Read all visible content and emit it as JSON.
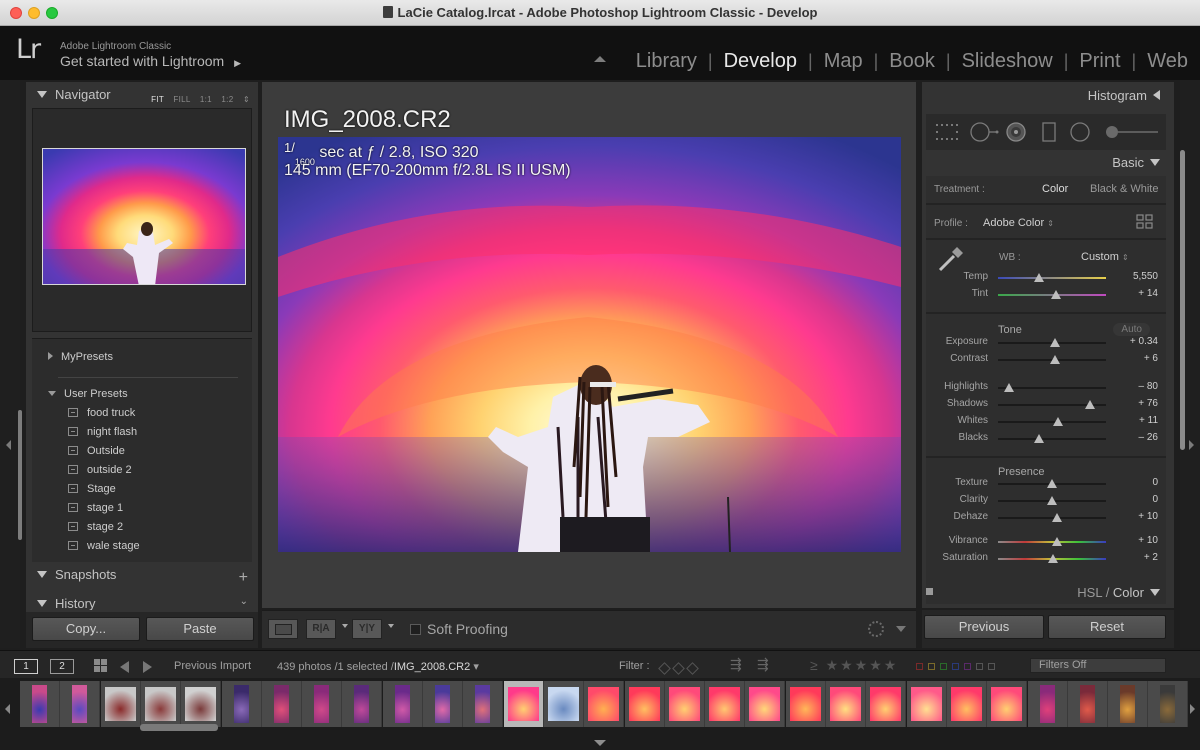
{
  "window": {
    "title": "LaCie Catalog.lrcat - Adobe Photoshop Lightroom Classic - Develop"
  },
  "identity_plate": {
    "logo": "Lr",
    "small": "Adobe Lightroom Classic",
    "big": "Get started with Lightroom",
    "arrow": "▶"
  },
  "modules": [
    {
      "label": "Library"
    },
    {
      "label": "Develop"
    },
    {
      "label": "Map"
    },
    {
      "label": "Book"
    },
    {
      "label": "Slideshow"
    },
    {
      "label": "Print"
    },
    {
      "label": "Web"
    }
  ],
  "active_module": "Develop",
  "left_panel": {
    "navigator": {
      "title": "Navigator",
      "zoom": [
        "FIT",
        "FILL",
        "1:1",
        "1:2"
      ],
      "zoom_arrows": "⇕"
    },
    "presets": {
      "my_presets": "MyPresets",
      "user_presets": "User Presets",
      "items": [
        "food truck",
        "night flash",
        "Outside",
        "outside 2",
        "Stage",
        "stage 1",
        "stage 2",
        "wale stage"
      ]
    },
    "snapshots": {
      "title": "Snapshots",
      "add": "+"
    },
    "history": {
      "title": "History",
      "chevron": "⌄"
    },
    "copy_button": "Copy...",
    "paste_button": "Paste"
  },
  "photo": {
    "filename": "IMG_2008.CR2",
    "shutter_num": "1/",
    "shutter_den": "1600",
    "exposure_rest": " sec at ƒ / 2.8, ISO 320",
    "lens_line": "145 mm (EF70-200mm f/2.8L IS II USM)"
  },
  "toolbar": {
    "before_after_1": "R|A",
    "before_after_2": "Y|Y",
    "soft_proofing": "Soft Proofing"
  },
  "right_panel": {
    "histogram": "Histogram",
    "basic": "Basic",
    "treatment_label": "Treatment :",
    "treatment_color": "Color",
    "treatment_bw": "Black & White",
    "profile_label": "Profile :",
    "profile_value": "Adobe Color",
    "profile_arrow": "⇕",
    "wb_label": "WB :",
    "wb_value": "Custom",
    "wb_arrow": "⇕",
    "tone_title": "Tone",
    "auto": "Auto",
    "presence_title": "Presence",
    "hsl_label": "HSL",
    "color_label": "Color",
    "hsl_sep": " / ",
    "sliders": {
      "temp": {
        "label": "Temp",
        "value": "5,550",
        "pos": 0.38
      },
      "tint": {
        "label": "Tint",
        "value": "+ 14",
        "pos": 0.54
      },
      "exposure": {
        "label": "Exposure",
        "value": "+ 0.34",
        "pos": 0.53
      },
      "contrast": {
        "label": "Contrast",
        "value": "+ 6",
        "pos": 0.53
      },
      "highlights": {
        "label": "Highlights",
        "value": "– 80",
        "pos": 0.1
      },
      "shadows": {
        "label": "Shadows",
        "value": "+ 76",
        "pos": 0.85
      },
      "whites": {
        "label": "Whites",
        "value": "+ 11",
        "pos": 0.56
      },
      "blacks": {
        "label": "Blacks",
        "value": "– 26",
        "pos": 0.38
      },
      "texture": {
        "label": "Texture",
        "value": "0",
        "pos": 0.5
      },
      "clarity": {
        "label": "Clarity",
        "value": "0",
        "pos": 0.5
      },
      "dehaze": {
        "label": "Dehaze",
        "value": "+ 10",
        "pos": 0.55
      },
      "vibrance": {
        "label": "Vibrance",
        "value": "+ 10",
        "pos": 0.55
      },
      "saturation": {
        "label": "Saturation",
        "value": "+ 2",
        "pos": 0.51
      }
    },
    "previous_button": "Previous",
    "reset_button": "Reset"
  },
  "filmstrip": {
    "monitor1": "1",
    "monitor2": "2",
    "source": "Previous Import",
    "count": "439 photos /1 selected /",
    "selected_file": "IMG_2008.CR2",
    "dropdown": "▾",
    "filter_label": "Filter :",
    "stars": "≥ ★★★★★",
    "filters_off": "Filters Off"
  }
}
